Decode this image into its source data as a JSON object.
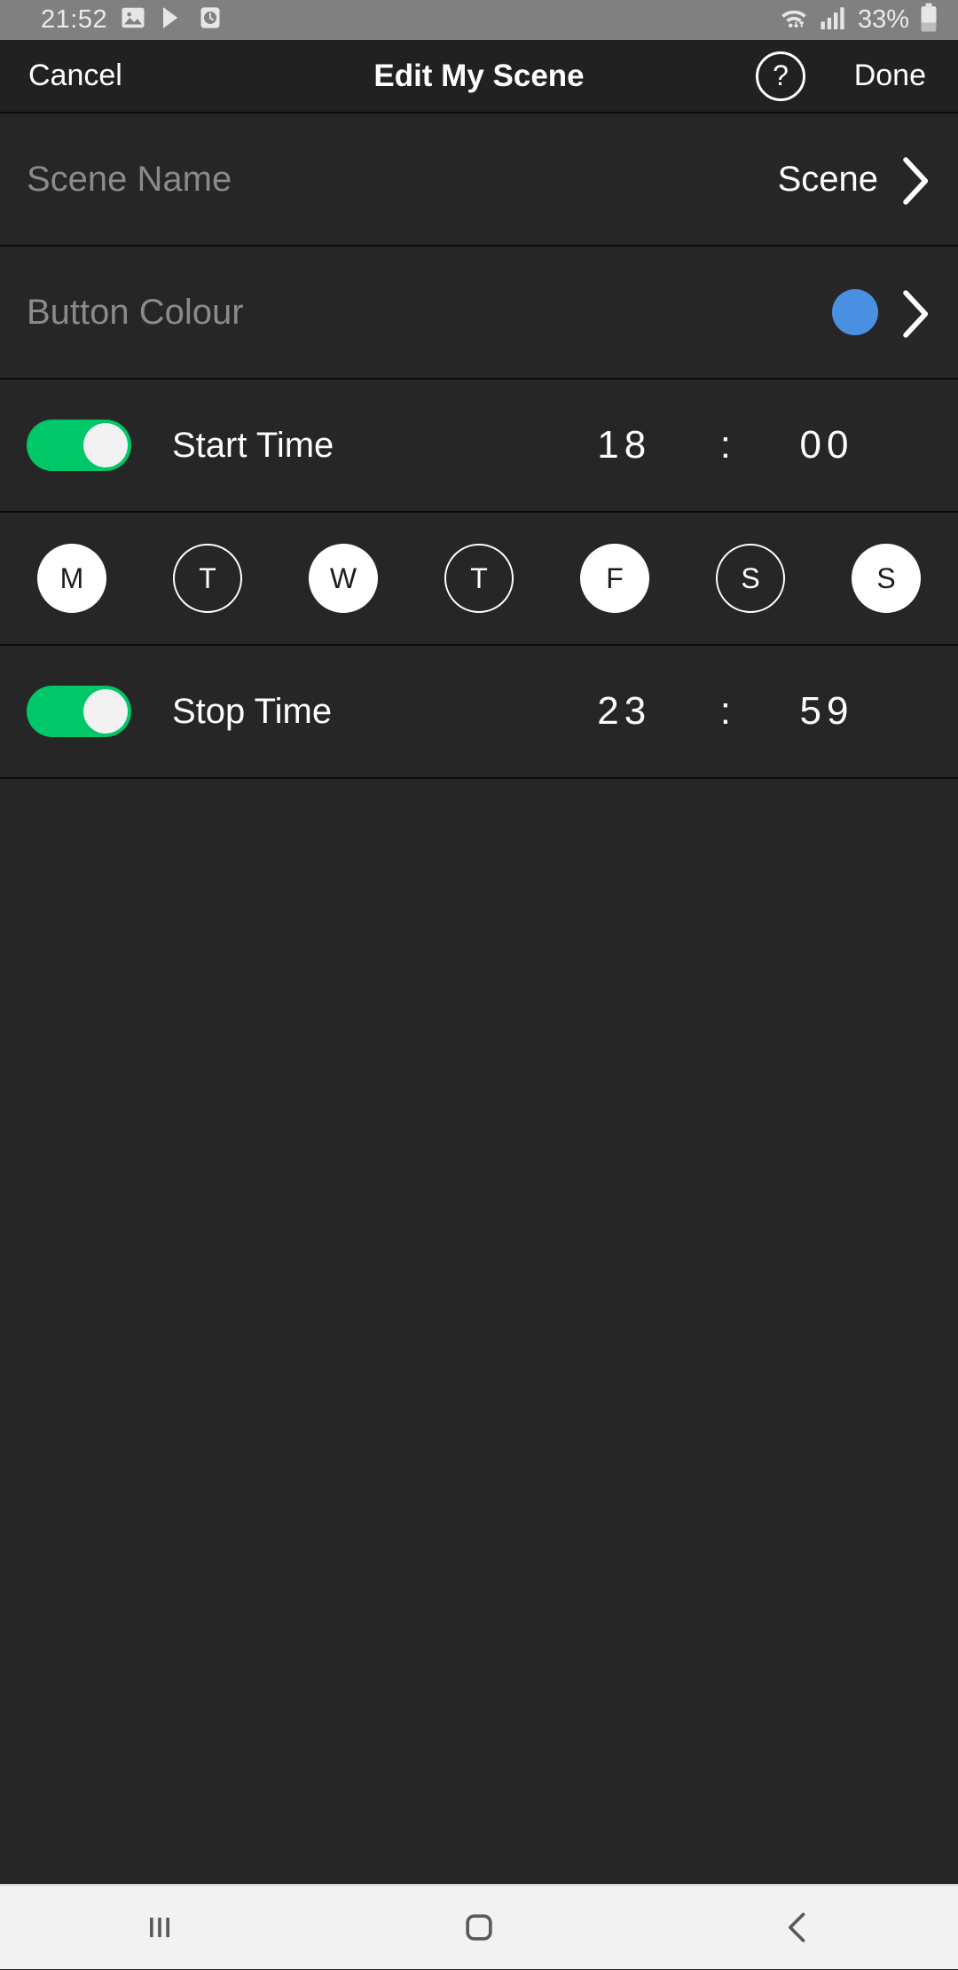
{
  "status_bar": {
    "time": "21:52",
    "battery_percent": "33%",
    "icons": [
      "gallery-icon",
      "play-store-icon",
      "clock-icon",
      "wifi-icon",
      "cellular-signal-icon",
      "battery-icon"
    ],
    "background": "#808080"
  },
  "header": {
    "cancel_label": "Cancel",
    "title": "Edit My Scene",
    "help_label": "?",
    "done_label": "Done"
  },
  "rows": {
    "scene_name": {
      "label": "Scene Name",
      "value": "Scene"
    },
    "button_colour": {
      "label": "Button Colour",
      "colour": "#4a90e2"
    },
    "start_time": {
      "label": "Start Time",
      "enabled": "on",
      "hours": "18",
      "separator": ":",
      "minutes": "00"
    },
    "stop_time": {
      "label": "Stop Time",
      "enabled": "on",
      "hours": "23",
      "separator": ":",
      "minutes": "59"
    }
  },
  "days": [
    {
      "label": "M",
      "selected": true
    },
    {
      "label": "T",
      "selected": false
    },
    {
      "label": "W",
      "selected": true
    },
    {
      "label": "T",
      "selected": false
    },
    {
      "label": "F",
      "selected": true
    },
    {
      "label": "S",
      "selected": false
    },
    {
      "label": "S",
      "selected": true
    }
  ],
  "nav_bar": {
    "recents_label": "|||",
    "home_label": "home",
    "back_label": "back"
  },
  "colors": {
    "toggle_on": "#00c767",
    "accent_blue": "#4a90e2",
    "row_bg": "#262626",
    "header_bg": "#212121",
    "divider": "#0b0b0b",
    "label_grey": "#8a8a8a"
  }
}
